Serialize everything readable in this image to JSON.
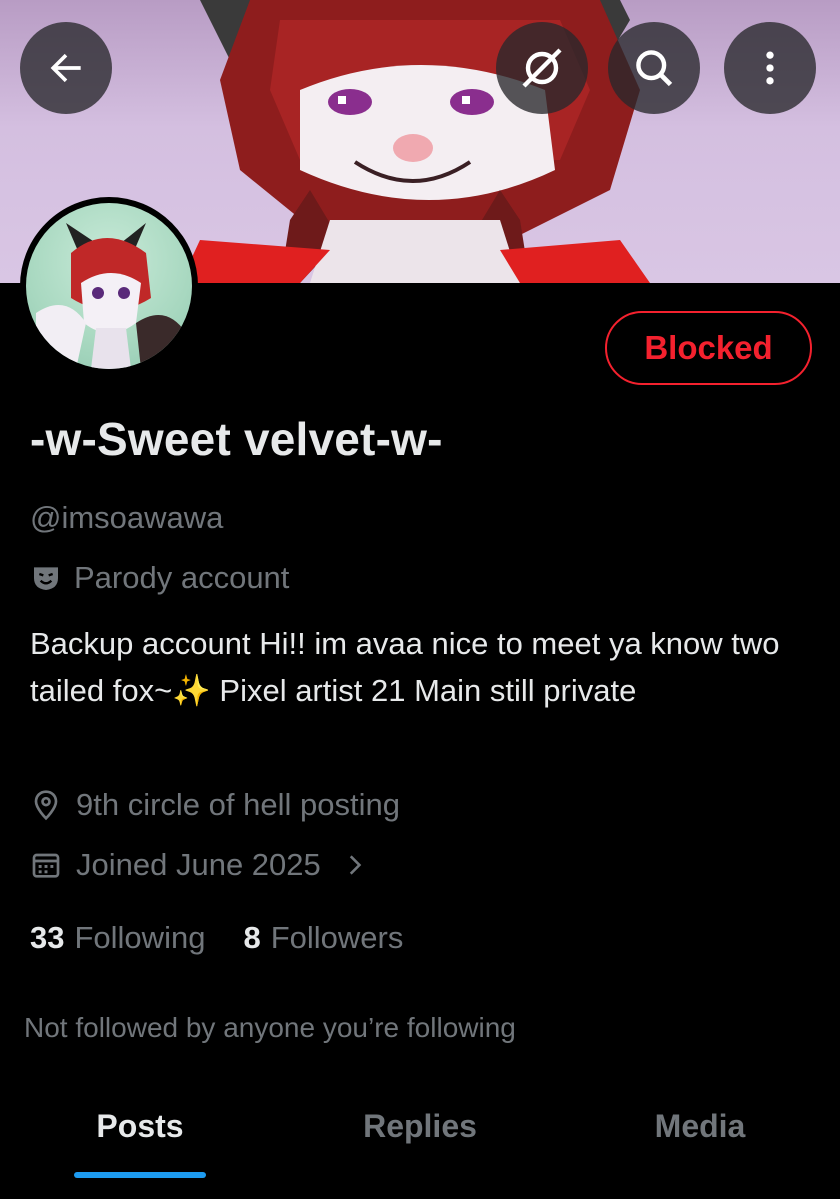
{
  "header": {
    "back_icon": "arrow-left-icon",
    "grok_icon": "grok-icon",
    "search_icon": "search-icon",
    "more_icon": "more-vertical-icon"
  },
  "profile": {
    "display_name": "-w-Sweet velvet-w-",
    "handle": "@imsoawawa",
    "label_icon": "parody-mask-icon",
    "label": "Parody account",
    "bio": "Backup account  Hi!! im avaa nice to meet ya know two tailed fox~✨ Pixel artist 21  Main still private",
    "location_icon": "location-pin-icon",
    "location": "9th circle of hell posting",
    "joined_icon": "calendar-icon",
    "joined": "Joined June 2025",
    "following_count": "33",
    "following_label": "Following",
    "followers_count": "8",
    "followers_label": "Followers",
    "not_followed": "Not followed by anyone you’re following"
  },
  "actions": {
    "blocked_label": "Blocked"
  },
  "tabs": [
    {
      "label": "Posts",
      "active": true
    },
    {
      "label": "Replies",
      "active": false
    },
    {
      "label": "Media",
      "active": false
    }
  ],
  "colors": {
    "accent": "#1d9bf0",
    "blocked": "#f4212e",
    "muted": "#71767b",
    "text": "#e7e9ea",
    "background": "#000000"
  }
}
